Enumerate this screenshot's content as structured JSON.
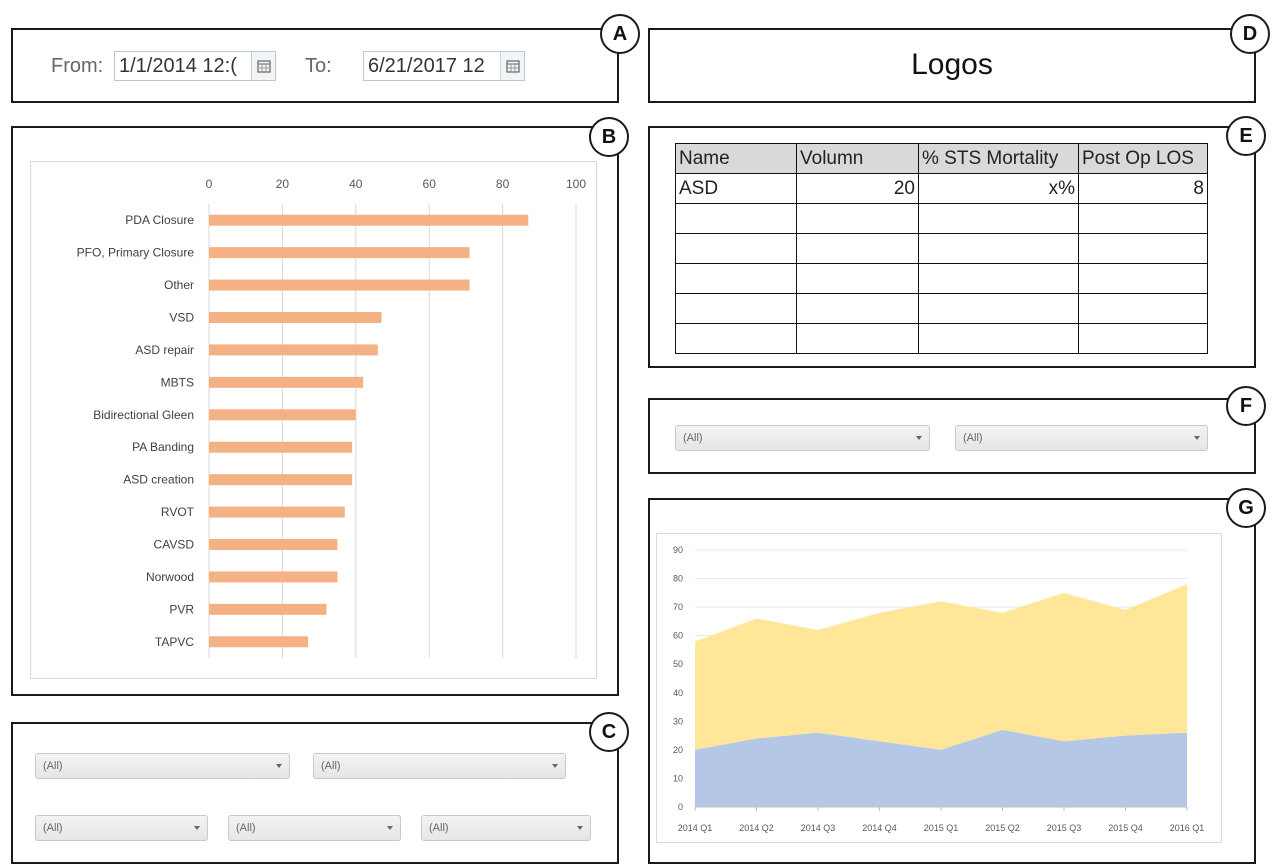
{
  "badges": {
    "a": "A",
    "b": "B",
    "c": "C",
    "d": "D",
    "e": "E",
    "f": "F",
    "g": "G"
  },
  "date_filter": {
    "from_label": "From:",
    "from_value": "1/1/2014 12:(",
    "to_label": "To:",
    "to_value": "6/21/2017 12",
    "calendar_icon": "calendar-icon"
  },
  "logos": {
    "text": "Logos"
  },
  "summary_table": {
    "headers": [
      "Name",
      "Volumn",
      "% STS Mortality",
      "Post Op LOS"
    ],
    "rows": [
      [
        "ASD",
        "20",
        "x%",
        "8"
      ],
      [
        "",
        "",
        "",
        ""
      ],
      [
        "",
        "",
        "",
        ""
      ],
      [
        "",
        "",
        "",
        ""
      ],
      [
        "",
        "",
        "",
        ""
      ],
      [
        "",
        "",
        "",
        ""
      ]
    ]
  },
  "filters_c": [
    "(All)",
    "(All)",
    "(All)",
    "(All)",
    "(All)"
  ],
  "filters_f": [
    "(All)",
    "(All)"
  ],
  "colors": {
    "bar": "#f4b183",
    "area_top": "#ffe699",
    "area_bottom": "#b4c7e7",
    "grid": "#d9d9d9",
    "tick": "#595959"
  },
  "chart_data": [
    {
      "type": "bar",
      "orientation": "horizontal",
      "categories": [
        "PDA Closure",
        "PFO, Primary Closure",
        "Other",
        "VSD",
        "ASD repair",
        "MBTS",
        "Bidirectional Gleen",
        "PA Banding",
        "ASD creation",
        "RVOT",
        "CAVSD",
        "Norwood",
        "PVR",
        "TAPVC"
      ],
      "values": [
        87,
        71,
        71,
        47,
        46,
        42,
        40,
        39,
        39,
        37,
        35,
        35,
        32,
        27
      ],
      "xlim": [
        0,
        100
      ],
      "xticks": [
        "0",
        "20",
        "40",
        "60",
        "80",
        "100"
      ],
      "title": "",
      "xlabel": "",
      "ylabel": "",
      "grid": true
    },
    {
      "type": "area",
      "stacked": true,
      "x": [
        "2014 Q1",
        "2014 Q2",
        "2014 Q3",
        "2014 Q4",
        "2015 Q1",
        "2015 Q2",
        "2015 Q3",
        "2015 Q4",
        "2016 Q1"
      ],
      "series": [
        {
          "values": [
            20,
            24,
            26,
            23,
            20,
            27,
            23,
            25,
            26
          ]
        },
        {
          "values": [
            38,
            42,
            36,
            45,
            52,
            41,
            52,
            44,
            52
          ]
        }
      ],
      "totals": [
        58,
        66,
        62,
        68,
        72,
        68,
        75,
        69,
        78
      ],
      "ylim": [
        0,
        90
      ],
      "yticks": [
        "0",
        "10",
        "20",
        "30",
        "40",
        "50",
        "60",
        "70",
        "80",
        "90"
      ],
      "title": "",
      "xlabel": "",
      "ylabel": "",
      "grid": true
    }
  ]
}
